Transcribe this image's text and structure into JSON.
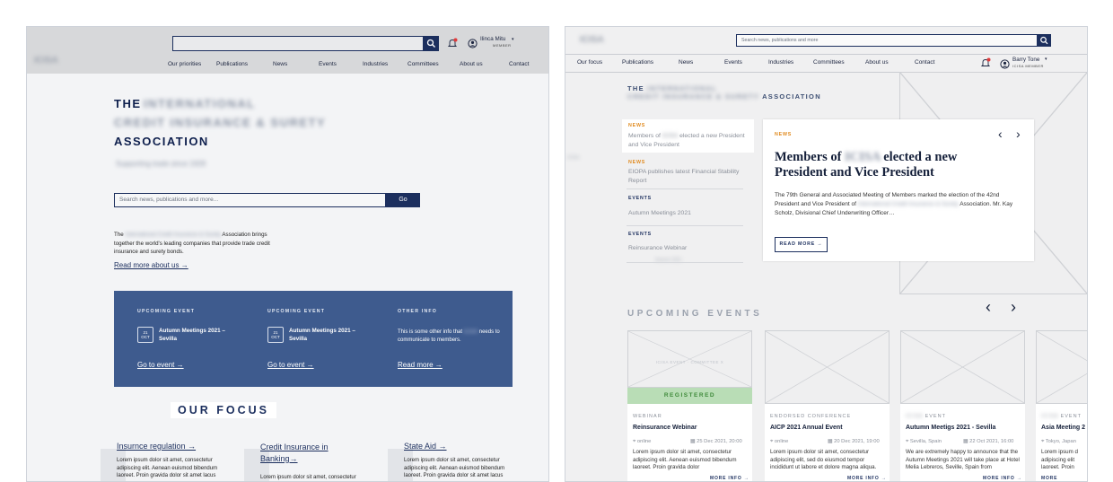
{
  "left": {
    "header": {
      "logo_text": "ICISA",
      "user_name": "Ilinca Mitu",
      "user_role": "MEMBER",
      "nav": [
        "Our priorities",
        "Publications",
        "News",
        "Events",
        "Industries",
        "Committees",
        "About us",
        "Contact"
      ]
    },
    "hero": {
      "title_line1_a": "THE",
      "title_line1_b": "INTERNATIONAL",
      "title_line2": "CREDIT INSURANCE & SURETY",
      "title_line3": "ASSOCIATION",
      "tagline": "Supporting trade since 1928",
      "search_placeholder": "Search news, publications and more...",
      "search_button": "Go",
      "intro_a": "The",
      "intro_blur": "International Credit Insurance & Surety",
      "intro_b": "Association brings together the world's leading companies that provide trade credit insurance and surety bonds.",
      "read_more": "Read more about us →"
    },
    "panel": {
      "col1": {
        "caption": "UPCOMING EVENT",
        "title": "Autumn Meetings 2021 – Sevilla",
        "cal_day": "21",
        "cal_month": "OCT",
        "link": "Go to event →"
      },
      "col2": {
        "caption": "UPCOMING EVENT",
        "title": "Autumn Meetings 2021 – Sevilla",
        "cal_day": "21",
        "cal_month": "OCT",
        "link": "Go to event →"
      },
      "col3": {
        "caption": "OTHER INFO",
        "text_a": "This is some other info that",
        "text_blur": "ICISA",
        "text_b": "needs to communicate to members.",
        "link": "Read more →"
      }
    },
    "focus": {
      "heading": "OUR FOCUS",
      "items": [
        {
          "title": "Insurnce regulation →",
          "body": "Lorem ipsum dolor sit amet, consectetur adipiscing elit. Aenean euismod bibendum laoreet. Proin gravida dolor sit amet lacus"
        },
        {
          "title": "Credit Insurance in Banking→",
          "body": "Lorem ipsum dolor sit amet, consectetur"
        },
        {
          "title": "State Aid →",
          "body": "Lorem ipsum dolor sit amet, consectetur adipiscing elit. Aenean euismod bibendum laoreet. Proin gravida dolor sit amet lacus"
        }
      ]
    }
  },
  "right": {
    "header": {
      "logo_text": "ICISA",
      "search_placeholder": "Search news, publications and more",
      "nav": [
        "Our focus",
        "Publications",
        "News",
        "Events",
        "Industries",
        "Committees",
        "About us",
        "Contact"
      ],
      "user_name": "Barry Tone",
      "user_role": "ICISA MEMBER"
    },
    "hero": {
      "line1_a": "THE",
      "line1_blur": "INTERNATIONAL",
      "line2_blur": "CREDIT INSURANCE & SURETY",
      "line2_b": "ASSOCIATION"
    },
    "side_label": "ICISA",
    "sidebar": [
      {
        "tag": "NEWS",
        "text_a": "Members of",
        "text_blur": "ICISA",
        "text_b": "elected a new President and Vice President",
        "active": true
      },
      {
        "tag": "NEWS",
        "text_a": "EIOPA publishes latest Financial Stability Report",
        "active": false
      },
      {
        "tag": "EVENTS",
        "text_a": "Autumn Meetings 2021",
        "active": false
      },
      {
        "tag": "EVENTS",
        "text_a": "Reinsurance Webinar",
        "text_extra": "Autumn 2021",
        "active": false
      }
    ],
    "feature": {
      "tag": "NEWS",
      "title_a": "Members of",
      "title_blur": "ICISA",
      "title_b": "elected a new President and Vice President",
      "body_a": "The 79th General and Associated Meeting of Members marked the election of the 42nd President and Vice President of",
      "body_blur": "International Credit Insurance & Surety",
      "body_b": "Association. Mr. Kay Scholz, Divisional Chief Underwriting Officer…",
      "button": "READ MORE →"
    },
    "events_heading": "UPCOMING EVENTS",
    "events": [
      {
        "image_caption": "ICISA EVENT · COMMITTEE X",
        "badge": "REGISTERED",
        "category": "WEBINAR",
        "category_blur": "",
        "title": "Reinsurance Webinar",
        "location": "online",
        "date": "25 Dec 2021, 20:00",
        "body": "Lorem ipsum dolor sit amet, consectetur adipiscing elit. Aenean euismod bibendum laoreet. Proin gravida dolor",
        "more": "MORE INFO →"
      },
      {
        "image_caption": "",
        "badge": "",
        "category": "ENDORSED CONFERENCE",
        "category_blur": "",
        "title": "AICP 2021 Annual Event",
        "location": "online",
        "date": "20 Dec 2021, 19:00",
        "body": "Lorem ipsum dolor sit amet, consectetur adipiscing elit, sed do eiusmod tempor incididunt ut labore et dolore magna aliqua.",
        "more": "MORE INFO →"
      },
      {
        "image_caption": "",
        "badge": "",
        "category": "EVENT",
        "category_blur": "ICISA",
        "title": "Autumn Meetigs 2021 - Sevilla",
        "location": "Sevilla, Spain",
        "date": "22 Oct 2021, 16:00",
        "body": "We are extremely happy to announce that the Autumn Meetings 2021 will take place at Hotel Melia Lebreros, Seville, Spain from",
        "more": "MORE INFO →"
      },
      {
        "image_caption": "",
        "badge": "",
        "category": "EVENT",
        "category_blur": "ICISA",
        "title": "Asia Meeting 2",
        "location": "Tokyo, Japan",
        "date": "",
        "body": "Lorem ipsum d adipiscing elit laoreet. Proin",
        "more": "MORE"
      }
    ]
  }
}
